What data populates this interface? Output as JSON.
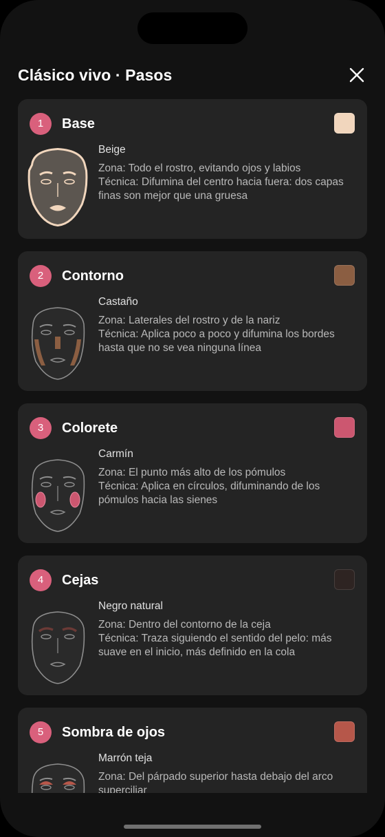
{
  "header": {
    "title": "Clásico vivo · Pasos",
    "close_icon": "close-icon"
  },
  "accent_color": "#d9607c",
  "steps": [
    {
      "number": "1",
      "title": "Base",
      "color_hex": "#f1d6bd",
      "color_name": "Beige",
      "zone": "Zona: Todo el rostro, evitando ojos y labios",
      "technique": "Técnica: Difumina del centro hacia fuera: dos capas finas son mejor que una gruesa",
      "face_icon": "face-base-icon"
    },
    {
      "number": "2",
      "title": "Contorno",
      "color_hex": "#8b5e42",
      "color_name": "Castaño",
      "zone": "Zona: Laterales del rostro y de la nariz",
      "technique": "Técnica: Aplica poco a poco y difumina los bordes hasta que no se vea ninguna línea",
      "face_icon": "face-contour-icon"
    },
    {
      "number": "3",
      "title": "Colorete",
      "color_hex": "#cc5770",
      "color_name": "Carmín",
      "zone": "Zona: El punto más alto de los pómulos",
      "technique": "Técnica: Aplica en círculos, difuminando de los pómulos hacia las sienes",
      "face_icon": "face-blush-icon"
    },
    {
      "number": "4",
      "title": "Cejas",
      "color_hex": "#2e2422",
      "color_name": "Negro natural",
      "zone": "Zona: Dentro del contorno de la ceja",
      "technique": "Técnica: Traza siguiendo el sentido del pelo: más suave en el inicio, más definido en la cola",
      "face_icon": "face-brows-icon"
    },
    {
      "number": "5",
      "title": "Sombra de ojos",
      "color_hex": "#b6574a",
      "color_name": "Marrón teja",
      "zone": "Zona: Del párpado superior hasta debajo del arco superciliar",
      "technique": "",
      "face_icon": "face-eyeshadow-icon"
    }
  ]
}
